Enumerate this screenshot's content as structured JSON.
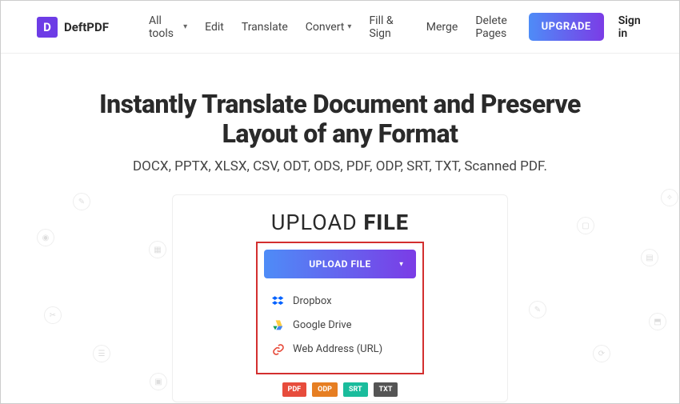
{
  "brand": {
    "letter": "D",
    "name": "DeftPDF"
  },
  "nav": {
    "all_tools": "All tools",
    "edit": "Edit",
    "translate": "Translate",
    "convert": "Convert",
    "fill_sign": "Fill & Sign",
    "merge": "Merge",
    "delete_pages": "Delete Pages"
  },
  "header": {
    "upgrade": "UPGRADE",
    "signin": "Sign in"
  },
  "hero": {
    "title_l1": "Instantly Translate Document and Preserve",
    "title_l2": "Layout of any Format",
    "subtitle": "DOCX, PPTX, XLSX, CSV, ODT, ODS, PDF, ODP, SRT, TXT, Scanned PDF."
  },
  "upload": {
    "heading_light": "UPLOAD ",
    "heading_bold": "FILE",
    "button": "UPLOAD FILE",
    "sources": {
      "dropbox": "Dropbox",
      "gdrive": "Google Drive",
      "url": "Web Address (URL)"
    }
  },
  "badges": {
    "pdf": "PDF",
    "odp": "ODP",
    "srt": "SRT",
    "txt": "TXT"
  },
  "colors": {
    "pdf": "#e74c3c",
    "odp": "#e67e22",
    "srt": "#1abc9c",
    "txt": "#555"
  }
}
